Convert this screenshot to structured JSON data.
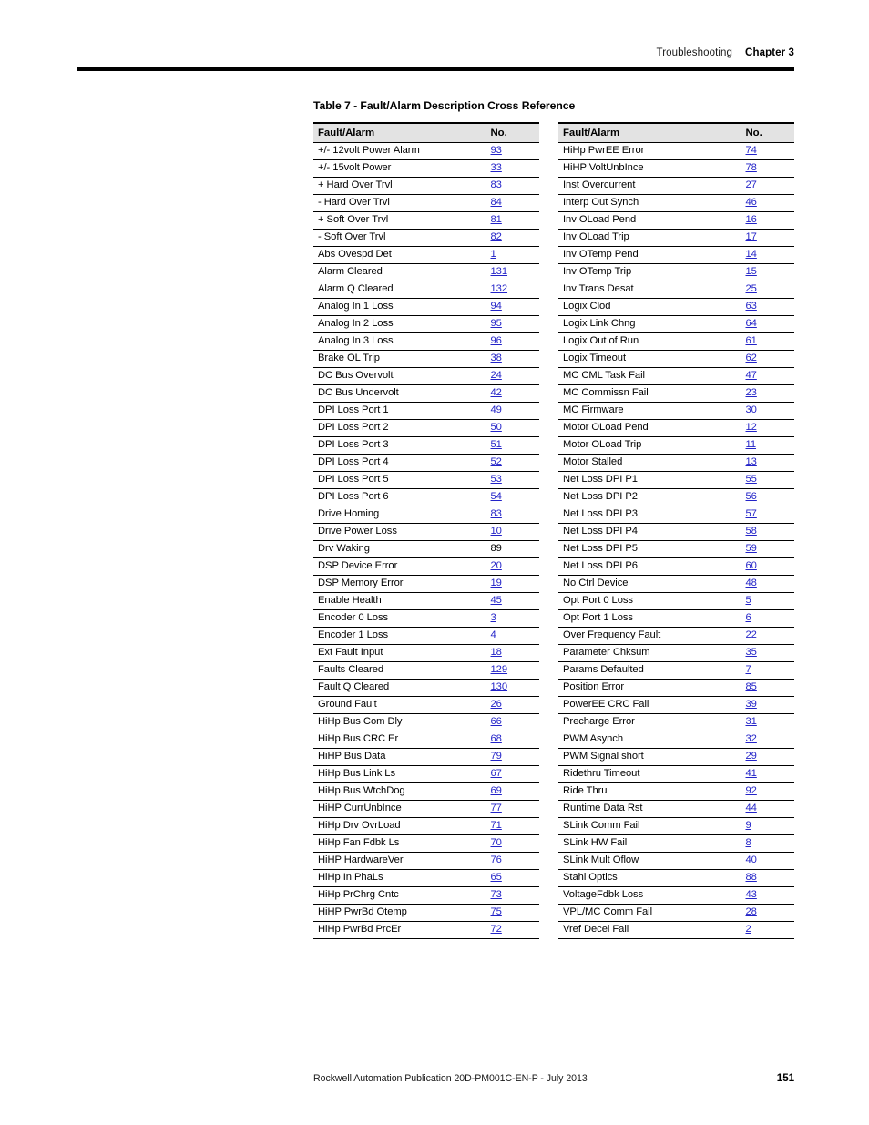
{
  "header": {
    "section": "Troubleshooting",
    "chapter": "Chapter 3"
  },
  "caption": "Table 7 - Fault/Alarm Description Cross Reference",
  "colors": {
    "link": "#2323c8",
    "header_fill": "#e3e3e3",
    "rule": "#000000"
  },
  "table": {
    "columns": [
      "Fault/Alarm",
      "No."
    ],
    "left": {
      "header": {
        "name": "Fault/Alarm",
        "no": "No."
      },
      "rows": [
        {
          "name": "+/- 12volt Power Alarm",
          "no": "93",
          "link": true
        },
        {
          "name": "+/- 15volt Power",
          "no": "33",
          "link": true
        },
        {
          "name": "+ Hard Over Trvl",
          "no": "83",
          "link": true
        },
        {
          "name": "- Hard Over Trvl",
          "no": "84",
          "link": true
        },
        {
          "name": "+ Soft Over Trvl",
          "no": "81",
          "link": true
        },
        {
          "name": "- Soft Over Trvl",
          "no": "82",
          "link": true
        },
        {
          "name": "Abs Ovespd Det",
          "no": "1",
          "link": true
        },
        {
          "name": "Alarm Cleared",
          "no": "131",
          "link": true
        },
        {
          "name": "Alarm Q Cleared",
          "no": "132",
          "link": true
        },
        {
          "name": "Analog In 1 Loss",
          "no": "94",
          "link": true
        },
        {
          "name": "Analog In 2 Loss",
          "no": "95",
          "link": true
        },
        {
          "name": "Analog In 3 Loss",
          "no": "96",
          "link": true
        },
        {
          "name": "Brake OL Trip",
          "no": "38",
          "link": true
        },
        {
          "name": "DC Bus Overvolt",
          "no": "24",
          "link": true
        },
        {
          "name": "DC Bus Undervolt",
          "no": "42",
          "link": true
        },
        {
          "name": "DPI Loss Port 1",
          "no": "49",
          "link": true
        },
        {
          "name": "DPI Loss Port 2",
          "no": "50",
          "link": true
        },
        {
          "name": "DPI Loss Port 3",
          "no": "51",
          "link": true
        },
        {
          "name": "DPI Loss Port 4",
          "no": "52",
          "link": true
        },
        {
          "name": "DPI Loss Port 5",
          "no": "53",
          "link": true
        },
        {
          "name": "DPI Loss Port 6",
          "no": "54",
          "link": true
        },
        {
          "name": "Drive Homing",
          "no": "83",
          "link": true
        },
        {
          "name": "Drive Power Loss",
          "no": "10",
          "link": true
        },
        {
          "name": "Drv Waking",
          "no": "89",
          "link": false
        },
        {
          "name": "DSP Device Error",
          "no": "20",
          "link": true
        },
        {
          "name": "DSP Memory Error",
          "no": "19",
          "link": true
        },
        {
          "name": "Enable Health",
          "no": "45",
          "link": true
        },
        {
          "name": "Encoder 0 Loss",
          "no": "3",
          "link": true
        },
        {
          "name": "Encoder 1 Loss",
          "no": "4",
          "link": true
        },
        {
          "name": "Ext Fault Input",
          "no": "18",
          "link": true
        },
        {
          "name": "Faults Cleared",
          "no": "129",
          "link": true
        },
        {
          "name": "Fault Q Cleared",
          "no": "130",
          "link": true
        },
        {
          "name": "Ground Fault",
          "no": "26",
          "link": true
        },
        {
          "name": "HiHp Bus Com Dly",
          "no": "66",
          "link": true
        },
        {
          "name": "HiHp Bus CRC Er",
          "no": "68",
          "link": true
        },
        {
          "name": "HiHP Bus Data",
          "no": "79",
          "link": true
        },
        {
          "name": "HiHp Bus Link Ls",
          "no": "67",
          "link": true
        },
        {
          "name": "HiHp Bus WtchDog",
          "no": "69",
          "link": true
        },
        {
          "name": "HiHP CurrUnbInce",
          "no": "77",
          "link": true
        },
        {
          "name": "HiHp Drv OvrLoad",
          "no": "71",
          "link": true
        },
        {
          "name": "HiHp Fan Fdbk Ls",
          "no": "70",
          "link": true
        },
        {
          "name": "HiHP HardwareVer",
          "no": "76",
          "link": true
        },
        {
          "name": "HiHp In PhaLs",
          "no": "65",
          "link": true
        },
        {
          "name": "HiHp PrChrg Cntc",
          "no": "73",
          "link": true
        },
        {
          "name": "HiHP PwrBd Otemp",
          "no": "75",
          "link": true
        },
        {
          "name": "HiHp PwrBd PrcEr",
          "no": "72",
          "link": true
        }
      ]
    },
    "right": {
      "header": {
        "name": "Fault/Alarm",
        "no": "No."
      },
      "rows": [
        {
          "name": "HiHp PwrEE Error",
          "no": "74",
          "link": true
        },
        {
          "name": "HiHP VoltUnbInce",
          "no": "78",
          "link": true
        },
        {
          "name": "Inst Overcurrent",
          "no": "27",
          "link": true
        },
        {
          "name": "Interp Out Synch",
          "no": "46",
          "link": true
        },
        {
          "name": "Inv OLoad Pend",
          "no": "16",
          "link": true
        },
        {
          "name": "Inv OLoad Trip",
          "no": "17",
          "link": true
        },
        {
          "name": "Inv OTemp Pend",
          "no": "14",
          "link": true
        },
        {
          "name": "Inv OTemp Trip",
          "no": "15",
          "link": true
        },
        {
          "name": "Inv Trans Desat",
          "no": "25",
          "link": true
        },
        {
          "name": "Logix Clod",
          "no": "63",
          "link": true
        },
        {
          "name": "Logix Link Chng",
          "no": "64",
          "link": true
        },
        {
          "name": "Logix Out of Run",
          "no": "61",
          "link": true
        },
        {
          "name": "Logix Timeout",
          "no": "62",
          "link": true
        },
        {
          "name": "MC CML Task Fail",
          "no": "47",
          "link": true
        },
        {
          "name": "MC Commissn Fail",
          "no": "23",
          "link": true
        },
        {
          "name": "MC Firmware",
          "no": "30",
          "link": true
        },
        {
          "name": "Motor OLoad Pend",
          "no": "12",
          "link": true
        },
        {
          "name": "Motor OLoad Trip",
          "no": "11",
          "link": true
        },
        {
          "name": "Motor Stalled",
          "no": "13",
          "link": true
        },
        {
          "name": "Net Loss DPI P1",
          "no": "55",
          "link": true
        },
        {
          "name": "Net Loss DPI P2",
          "no": "56",
          "link": true
        },
        {
          "name": "Net Loss DPI P3",
          "no": "57",
          "link": true
        },
        {
          "name": "Net Loss DPI P4",
          "no": "58",
          "link": true
        },
        {
          "name": "Net Loss DPI P5",
          "no": "59",
          "link": true
        },
        {
          "name": "Net Loss DPI P6",
          "no": "60",
          "link": true
        },
        {
          "name": "No Ctrl Device",
          "no": "48",
          "link": true
        },
        {
          "name": "Opt Port 0 Loss",
          "no": "5",
          "link": true
        },
        {
          "name": "Opt Port 1 Loss",
          "no": "6",
          "link": true
        },
        {
          "name": "Over Frequency Fault",
          "no": "22",
          "link": true
        },
        {
          "name": "Parameter Chksum",
          "no": "35",
          "link": true
        },
        {
          "name": "Params Defaulted",
          "no": "7",
          "link": true
        },
        {
          "name": "Position Error",
          "no": "85",
          "link": true
        },
        {
          "name": "PowerEE CRC Fail",
          "no": "39",
          "link": true
        },
        {
          "name": "Precharge Error",
          "no": "31",
          "link": true
        },
        {
          "name": "PWM Asynch",
          "no": "32",
          "link": true
        },
        {
          "name": "PWM Signal short",
          "no": "29",
          "link": true
        },
        {
          "name": "Ridethru Timeout",
          "no": "41",
          "link": true
        },
        {
          "name": "Ride Thru",
          "no": "92",
          "link": true
        },
        {
          "name": "Runtime Data Rst",
          "no": "44",
          "link": true
        },
        {
          "name": "SLink Comm Fail",
          "no": "9",
          "link": true
        },
        {
          "name": "SLink HW Fail",
          "no": "8",
          "link": true
        },
        {
          "name": "SLink Mult Oflow",
          "no": "40",
          "link": true
        },
        {
          "name": "Stahl Optics",
          "no": "88",
          "link": true
        },
        {
          "name": "VoltageFdbk Loss",
          "no": "43",
          "link": true
        },
        {
          "name": "VPL/MC Comm Fail",
          "no": "28",
          "link": true
        },
        {
          "name": "Vref Decel Fail",
          "no": "2",
          "link": true
        }
      ]
    }
  },
  "footer": {
    "publication": "Rockwell Automation Publication 20D-PM001C-EN-P - July 2013",
    "page_number": "151"
  }
}
